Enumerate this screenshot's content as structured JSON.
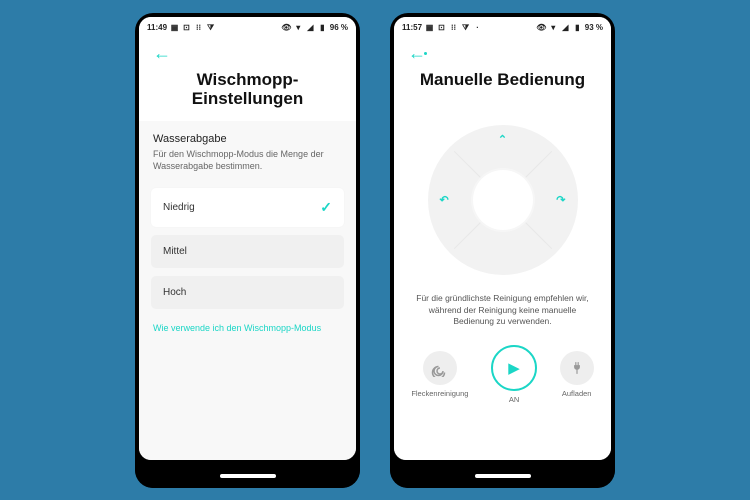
{
  "accent": "#1bd6c6",
  "screens": {
    "left": {
      "status": {
        "time": "11:49",
        "battery": "96 %",
        "icons_left": [
          "image-icon",
          "image-icon",
          "notif-icon",
          "filter-icon"
        ],
        "icons_right": [
          "eye-icon",
          "wifi-icon",
          "signal-icon",
          "battery-icon"
        ]
      },
      "title": "Wischmopp-Einstellungen",
      "section": {
        "label": "Wasserabgabe",
        "desc": "Für den Wischmopp-Modus die Menge der Wasserabgabe bestimmen."
      },
      "options": [
        {
          "label": "Niedrig",
          "selected": true
        },
        {
          "label": "Mittel",
          "selected": false
        },
        {
          "label": "Hoch",
          "selected": false
        }
      ],
      "help_link": "Wie verwende ich den Wischmopp-Modus"
    },
    "right": {
      "status": {
        "time": "11:57",
        "battery": "93 %",
        "icons_left": [
          "image-icon",
          "image-icon",
          "notif-icon",
          "filter-icon",
          "more-icon"
        ],
        "icons_right": [
          "eye-icon",
          "wifi-icon",
          "signal-icon",
          "battery-icon"
        ]
      },
      "title": "Manuelle Bedienung",
      "dpad": {
        "up": "⌃",
        "left": "↶",
        "right": "↷"
      },
      "tip": "Für die gründlichste Reinigung empfehlen wir, während der Reinigung keine manuelle Bedienung zu verwenden.",
      "actions": {
        "spot": {
          "label": "Fleckenreinigung",
          "icon": "◎"
        },
        "power": {
          "label": "AN",
          "icon": "▶"
        },
        "dock": {
          "label": "Aufladen",
          "icon": "⏚"
        }
      }
    }
  }
}
